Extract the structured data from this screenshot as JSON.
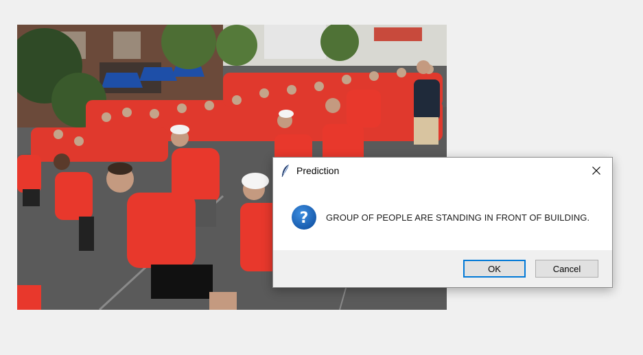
{
  "dialog": {
    "title": "Prediction",
    "title_icon": "feather-icon",
    "message_icon": "question-icon",
    "message": "GROUP OF PEOPLE ARE STANDING IN FRONT OF BUILDING.",
    "ok_label": "OK",
    "cancel_label": "Cancel",
    "close_icon": "close-icon"
  },
  "colors": {
    "accent": "#0078d7",
    "question_icon": "#1f66b3",
    "shirt_red": "#e8382c"
  }
}
